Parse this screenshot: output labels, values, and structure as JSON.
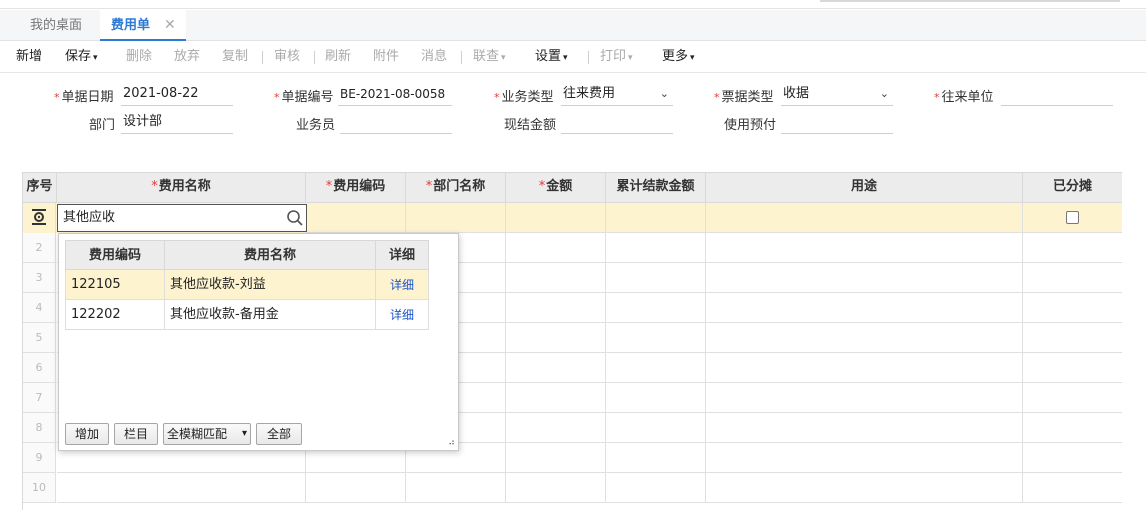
{
  "tabs": {
    "home": "我的桌面",
    "current": "费用单",
    "close": "✕"
  },
  "toolbar": {
    "add": "新增",
    "save": "保存",
    "delete": "删除",
    "discard": "放弃",
    "copy": "复制",
    "audit": "审核",
    "refresh": "刷新",
    "attach": "附件",
    "message": "消息",
    "linked_query": "联查",
    "settings": "设置",
    "print": "打印",
    "more": "更多",
    "dropdown_caret": "▾"
  },
  "form": {
    "doc_date_label": "单据日期",
    "doc_date": "2021-08-22",
    "doc_no_label": "单据编号",
    "doc_no": "BE-2021-08-0058",
    "biz_type_label": "业务类型",
    "biz_type": "往来费用",
    "bill_type_label": "票据类型",
    "bill_type": "收据",
    "partner_label": "往来单位",
    "partner": "",
    "dept_label": "部门",
    "dept": "设计部",
    "staff_label": "业务员",
    "staff": "",
    "cash_amount_label": "现结金额",
    "cash_amount": "",
    "prepay_label": "使用预付",
    "prepay": "",
    "required_mark": "*",
    "select_caret": "⌄"
  },
  "grid": {
    "headers": {
      "seq": "序号",
      "fee_name": "费用名称",
      "fee_code": "费用编码",
      "dept_name": "部门名称",
      "amount": "金额",
      "settled": "累计结款金额",
      "purpose": "用途",
      "allocated": "已分摊"
    },
    "row_numbers": [
      "2",
      "3",
      "4",
      "5",
      "6",
      "7",
      "8",
      "9",
      "10"
    ],
    "active_cell_value": "其他应收"
  },
  "popup": {
    "headers": {
      "code": "费用编码",
      "name": "费用名称",
      "detail": "详细"
    },
    "rows": [
      {
        "code": "122105",
        "name": "其他应收款-刘益",
        "detail": "详细"
      },
      {
        "code": "122202",
        "name": "其他应收款-备用金",
        "detail": "详细"
      }
    ],
    "buttons": {
      "add": "增加",
      "columns": "栏目",
      "match_mode": "全模糊匹配",
      "all": "全部"
    },
    "resize_glyph": "⠴"
  },
  "colors": {
    "accent": "#2d7ad6",
    "selected_row": "#fdf3cf",
    "required": "#e53935",
    "link": "#1b54c9"
  },
  "icons": [
    "search-icon",
    "gear-icon",
    "chevron-down-icon",
    "close-icon",
    "resize-handle-icon"
  ]
}
